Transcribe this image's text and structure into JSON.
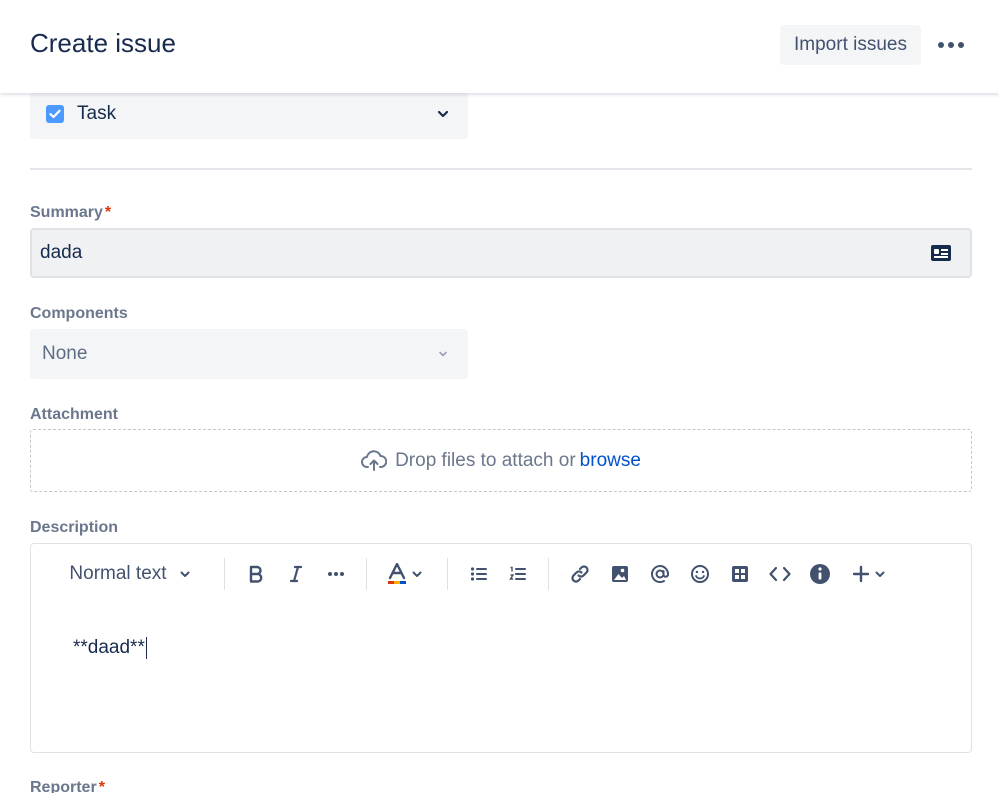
{
  "header": {
    "title": "Create issue",
    "import_label": "Import issues"
  },
  "issue_type": {
    "value": "Task"
  },
  "summary": {
    "label": "Summary",
    "required_mark": "*",
    "value": "dada"
  },
  "components": {
    "label": "Components",
    "value": "None"
  },
  "attachment": {
    "label": "Attachment",
    "drop_text": "Drop files to attach or",
    "browse_label": "browse"
  },
  "description": {
    "label": "Description",
    "text_style": "Normal text",
    "content": "**daad**",
    "toolbar_icons": [
      "bold-icon",
      "italic-icon",
      "more-formatting-icon",
      "text-color-icon",
      "bullet-list-icon",
      "numbered-list-icon",
      "link-icon",
      "image-icon",
      "mention-icon",
      "emoji-icon",
      "table-icon",
      "code-icon",
      "info-icon",
      "insert-plus-icon"
    ]
  },
  "reporter": {
    "label": "Reporter",
    "required_mark": "*"
  },
  "colors": {
    "accent": "#0052cc",
    "required": "#de350b",
    "checkbox": "#4c9aff"
  }
}
